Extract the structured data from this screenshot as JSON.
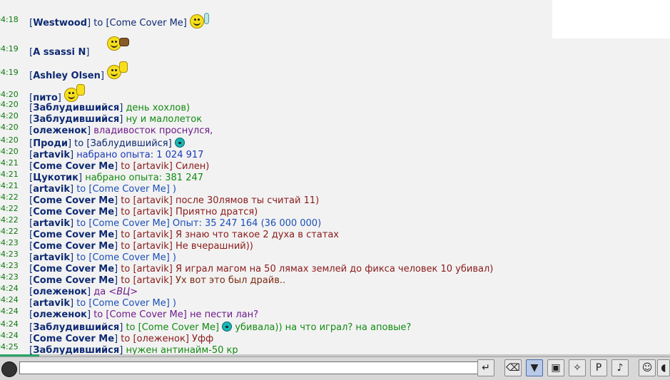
{
  "chat": {
    "lines": [
      {
        "time": "04:18",
        "nick": "Westwood",
        "to_word": "to",
        "target": "[Come Cover Me]",
        "msg": ""
      },
      {
        "time": "04:19",
        "nick": "A ssassi N",
        "msg": ""
      },
      {
        "time": "04:19",
        "nick": "Ashley Olsen",
        "msg": ""
      },
      {
        "time": "04:20",
        "nick": "пито",
        "msg": ""
      },
      {
        "time": "04:20",
        "nick": "Заблудившийся",
        "msg": "день хохлов)"
      },
      {
        "time": "04:20",
        "nick": "Заблудившийся",
        "msg": "ну и малолеток"
      },
      {
        "time": "04:20",
        "nick": "олеженок",
        "msg": "владивосток проснулся,"
      },
      {
        "time": "04:20",
        "nick": "Проди",
        "to_word": "to",
        "target": "[Заблудившийся]",
        "msg": ""
      },
      {
        "time": "04:20",
        "nick": "artavik",
        "msg": "набрано опыта: 1 024 917"
      },
      {
        "time": "04:21",
        "nick": "Come Cover Me",
        "to_word": "to",
        "target": "[artavik]",
        "msg": "Силен)"
      },
      {
        "time": "04:21",
        "nick": "Цукотик",
        "msg": "набрано опыта: 381 247"
      },
      {
        "time": "04:21",
        "nick": "artavik",
        "to_word": "to",
        "target": "[Come Cover Me]",
        "msg": ")"
      },
      {
        "time": "04:22",
        "nick": "Come Cover Me",
        "to_word": "to",
        "target": "[artavik]",
        "msg": "после 30лямов ты считай 11)"
      },
      {
        "time": "04:22",
        "nick": "Come Cover Me",
        "to_word": "to",
        "target": "[artavik]",
        "msg": "Приятно дратся)"
      },
      {
        "time": "04:22",
        "nick": "artavik",
        "to_word": "to",
        "target": "[Come Cover Me]",
        "msg": "Опыт: 35 247 164 (36 000 000)"
      },
      {
        "time": "04:22",
        "nick": "Come Cover Me",
        "to_word": "to",
        "target": "[artavik]",
        "msg": "Я знаю что такое 2 духа в статах"
      },
      {
        "time": "04:23",
        "nick": "Come Cover Me",
        "to_word": "to",
        "target": "[artavik]",
        "msg": "Не вчерашний))"
      },
      {
        "time": "04:23",
        "nick": "artavik",
        "to_word": "to",
        "target": "[Come Cover Me]",
        "msg": ")"
      },
      {
        "time": "04:23",
        "nick": "Come Cover Me",
        "to_word": "to",
        "target": "[artavik]",
        "msg": "Я играл магом на 50 лямах землей до фикса человек 10 убивал)"
      },
      {
        "time": "04:23",
        "nick": "Come Cover Me",
        "to_word": "to",
        "target": "[artavik]",
        "msg": "Ух вот это был драйв.."
      },
      {
        "time": "04:24",
        "nick": "олеженок",
        "msg": "да",
        "italic": "<ВЦ>"
      },
      {
        "time": "04:24",
        "nick": "artavik",
        "to_word": "to",
        "target": "[Come Cover Me]",
        "msg": ")"
      },
      {
        "time": "04:24",
        "nick": "олеженок",
        "to_word": "to",
        "target": "[Come Cover Me]",
        "msg": "не пести лан?"
      },
      {
        "time": "04:24",
        "nick": "Заблудившийся",
        "to_word": "to",
        "target": "[Come Cover Me]",
        "msg": "убивала)) на что играл? на аповые?"
      },
      {
        "time": "04:24",
        "nick": "Come Cover Me",
        "to_word": "to",
        "target": "[олеженок]",
        "msg": "Уфф"
      },
      {
        "time": "04:25",
        "nick": "Заблудившийся",
        "msg": "нужен антинайм-50 кр"
      }
    ]
  },
  "input": {
    "value": ""
  },
  "toolbar": {
    "buttons": [
      {
        "name": "send-button",
        "icon": "↵"
      },
      {
        "name": "clear-button",
        "icon": "⌫"
      },
      {
        "name": "filter-button",
        "icon": "▼"
      },
      {
        "name": "save-button",
        "icon": "▣"
      },
      {
        "name": "action-button",
        "icon": "✧"
      },
      {
        "name": "private-button",
        "icon": "P"
      },
      {
        "name": "sound-button",
        "icon": "♪"
      },
      {
        "name": "smiles-button",
        "icon": "☺"
      },
      {
        "name": "extra-button",
        "icon": "◖"
      }
    ]
  }
}
